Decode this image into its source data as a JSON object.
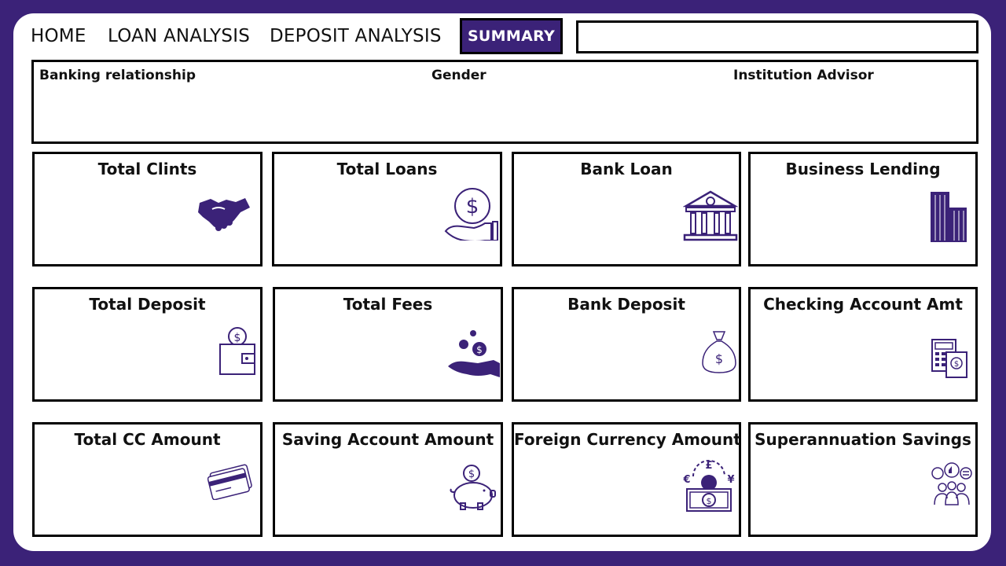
{
  "nav": {
    "home": "HOME",
    "loan_analysis": "LOAN ANALYSIS",
    "deposit_analysis": "DEPOSIT ANALYSIS",
    "summary": "SUMMARY",
    "active_tab": "SUMMARY"
  },
  "filters": {
    "banking_relationship": "Banking relationship",
    "gender": "Gender",
    "institution_advisor": "Institution Advisor"
  },
  "colors": {
    "brand": "#3b2278",
    "background": "#ffffff",
    "border": "#000000"
  },
  "cards": [
    {
      "title": "Total Clints",
      "icon": "handshake-icon"
    },
    {
      "title": "Total Loans",
      "icon": "coin-hand-icon"
    },
    {
      "title": "Bank Loan",
      "icon": "bank-building-icon"
    },
    {
      "title": "Business Lending",
      "icon": "skyscraper-icon"
    },
    {
      "title": "Total Deposit",
      "icon": "wallet-coin-icon"
    },
    {
      "title": "Total Fees",
      "icon": "hand-coins-icon"
    },
    {
      "title": "Bank Deposit",
      "icon": "money-bag-icon"
    },
    {
      "title": "Checking Account Amt",
      "icon": "calculator-invoice-icon"
    },
    {
      "title": "Total CC Amount",
      "icon": "credit-card-icon"
    },
    {
      "title": "Saving Account Amount",
      "icon": "piggy-bank-icon"
    },
    {
      "title": "Foreign Currency Amount",
      "icon": "currency-exchange-icon"
    },
    {
      "title": "Superannuation Savings",
      "icon": "people-feedback-icon"
    }
  ]
}
